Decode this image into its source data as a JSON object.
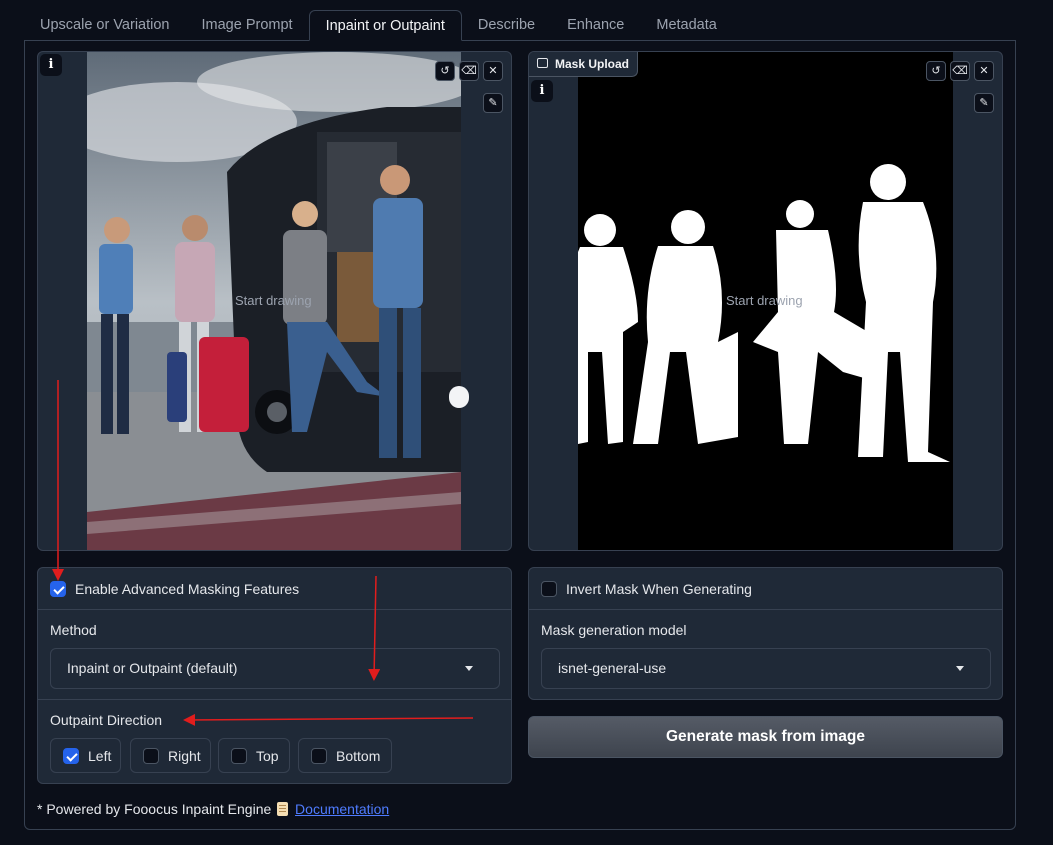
{
  "tabs": [
    {
      "label": "Upscale or Variation",
      "active": false
    },
    {
      "label": "Image Prompt",
      "active": false
    },
    {
      "label": "Inpaint or Outpaint",
      "active": true
    },
    {
      "label": "Describe",
      "active": false
    },
    {
      "label": "Enhance",
      "active": false
    },
    {
      "label": "Metadata",
      "active": false
    }
  ],
  "left_image": {
    "info_glyph": "i",
    "placeholder": "Start drawing",
    "icons": [
      "undo-icon",
      "eraser-icon",
      "close-icon",
      "brush-icon"
    ]
  },
  "right_image": {
    "upload_label": "Mask Upload",
    "info_glyph": "i",
    "placeholder": "Start drawing",
    "icons": [
      "image-icon",
      "undo-icon",
      "eraser-icon",
      "close-icon",
      "brush-icon"
    ]
  },
  "advanced": {
    "enable_label": "Enable Advanced Masking Features",
    "enable_checked": true,
    "method_label": "Method",
    "method_value": "Inpaint or Outpaint (default)",
    "direction_label": "Outpaint Direction",
    "directions": [
      {
        "label": "Left",
        "checked": true
      },
      {
        "label": "Right",
        "checked": false
      },
      {
        "label": "Top",
        "checked": false
      },
      {
        "label": "Bottom",
        "checked": false
      }
    ]
  },
  "mask": {
    "invert_label": "Invert Mask When Generating",
    "invert_checked": false,
    "model_label": "Mask generation model",
    "model_value": "isnet-general-use",
    "generate_label": "Generate mask from image"
  },
  "footer": {
    "prefix": "* Powered by Fooocus Inpaint Engine",
    "link": "Documentation"
  },
  "colors": {
    "background": "#0b0f19",
    "panel": "#1f2937",
    "border": "#374151",
    "accent": "#2563eb",
    "link": "#4f7cff",
    "annotation_arrow": "#e11d1d"
  }
}
